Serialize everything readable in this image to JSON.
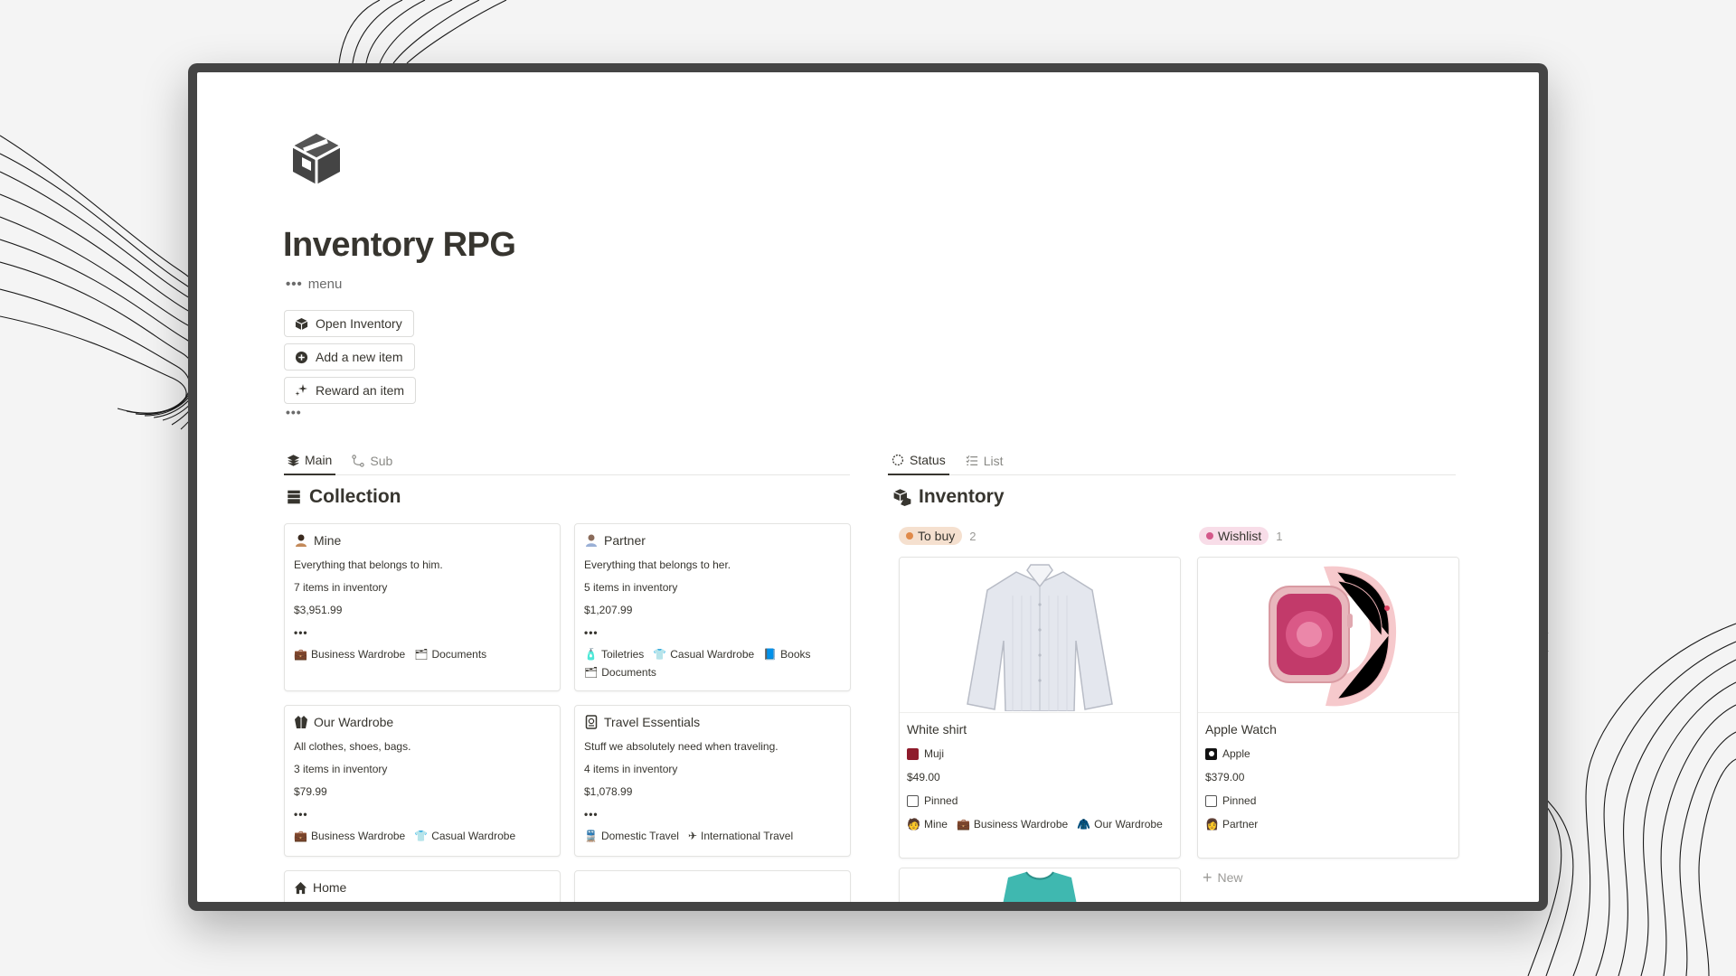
{
  "page": {
    "title": "Inventory RPG",
    "menu_label": "menu",
    "menu_dots": "•••",
    "more_dots": "•••"
  },
  "buttons": [
    {
      "label": "Open Inventory",
      "icon": "box-icon"
    },
    {
      "label": "Add a new item",
      "icon": "plus-circle-icon"
    },
    {
      "label": "Reward an item",
      "icon": "sparkle-icon"
    }
  ],
  "left_tabs": [
    {
      "label": "Main",
      "icon": "stack-icon",
      "active": true
    },
    {
      "label": "Sub",
      "icon": "branch-icon",
      "active": false
    }
  ],
  "right_tabs": [
    {
      "label": "Status",
      "icon": "status-icon",
      "active": true
    },
    {
      "label": "List",
      "icon": "list-icon",
      "active": false
    }
  ],
  "collection": {
    "title": "Collection",
    "cards": [
      {
        "title": "Mine",
        "desc": "Everything that belongs to him.",
        "count": "7 items in inventory",
        "value": "$3,951.99",
        "dots": "•••",
        "tags": [
          "Business Wardrobe",
          "Documents"
        ]
      },
      {
        "title": "Partner",
        "desc": "Everything that belongs to her.",
        "count": "5 items in inventory",
        "value": "$1,207.99",
        "dots": "•••",
        "tags": [
          "Toiletries",
          "Casual Wardrobe",
          "Books",
          "Documents"
        ]
      },
      {
        "title": "Our Wardrobe",
        "desc": "All clothes, shoes, bags.",
        "count": "3 items in inventory",
        "value": "$79.99",
        "dots": "•••",
        "tags": [
          "Business Wardrobe",
          "Casual Wardrobe"
        ]
      },
      {
        "title": "Travel Essentials",
        "desc": "Stuff we absolutely need when traveling.",
        "count": "4 items in inventory",
        "value": "$1,078.99",
        "dots": "•••",
        "tags": [
          "Domestic Travel",
          "International Travel"
        ]
      },
      {
        "title": "Home"
      }
    ]
  },
  "inventory": {
    "title": "Inventory",
    "columns": [
      {
        "label": "To buy",
        "count": "2",
        "color": "#f5e0cf",
        "dot": "#e08a4a",
        "item": {
          "title": "White shirt",
          "brand": "Muji",
          "price": "$49.00",
          "pinned": "Pinned",
          "tags": [
            "Mine",
            "Business Wardrobe",
            "Our Wardrobe"
          ]
        }
      },
      {
        "label": "Wishlist",
        "count": "1",
        "color": "#f8dde8",
        "dot": "#d4588a",
        "item": {
          "title": "Apple Watch",
          "brand": "Apple",
          "price": "$379.00",
          "pinned": "Pinned",
          "tags": [
            "Partner"
          ]
        }
      }
    ],
    "new_label": "New"
  }
}
